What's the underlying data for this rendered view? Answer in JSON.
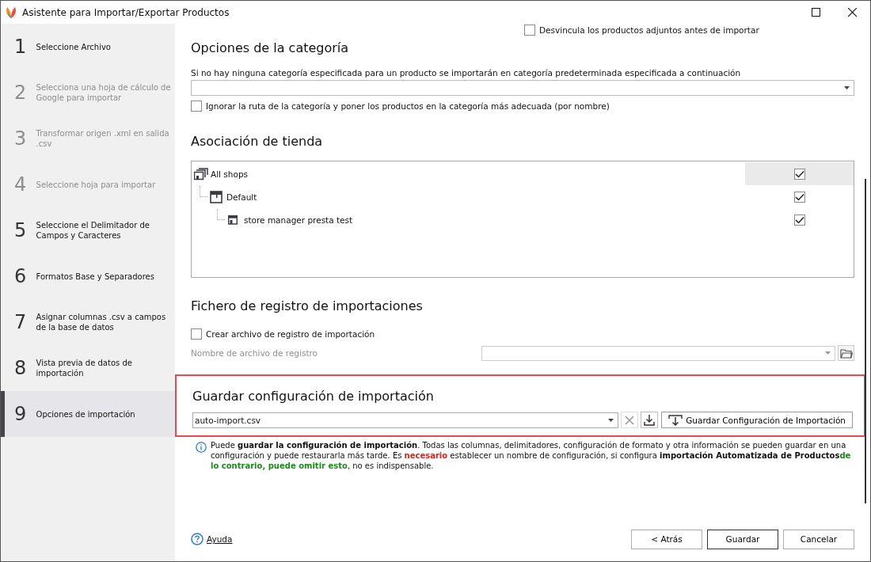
{
  "window": {
    "title": "Asistente para Importar/Exportar Productos"
  },
  "steps": [
    {
      "number": "1",
      "label": "Seleccione Archivo",
      "disabled": false,
      "selected": false
    },
    {
      "number": "2",
      "label": "Selecciona una hoja de cálculo de Google para importar",
      "disabled": true,
      "selected": false
    },
    {
      "number": "3",
      "label": "Transformar origen .xml en salida .csv",
      "disabled": true,
      "selected": false
    },
    {
      "number": "4",
      "label": "Seleccione hoja para importar",
      "disabled": true,
      "selected": false
    },
    {
      "number": "5",
      "label": "Seleccione el Delimitador de Campos y Caracteres",
      "disabled": false,
      "selected": false
    },
    {
      "number": "6",
      "label": "Formatos Base y Separadores",
      "disabled": false,
      "selected": false
    },
    {
      "number": "7",
      "label": "Asignar columnas .csv a campos de la base de datos",
      "disabled": false,
      "selected": false
    },
    {
      "number": "8",
      "label": "Vista previa de datos de importación",
      "disabled": false,
      "selected": false
    },
    {
      "number": "9",
      "label": "Opciones de importación",
      "disabled": false,
      "selected": true
    }
  ],
  "unlink_option": {
    "label": "Desvincula los productos adjuntos antes de importar",
    "checked": false
  },
  "category_section": {
    "title": "Opciones de la categoría",
    "description": "Si no hay ninguna categoría especificada para un producto se importarán en categoría predeterminada especificada a continuación",
    "ignore_path": {
      "label": "Ignorar la ruta de la categoría y poner los productos en la categoría más adecuada (por nombre)",
      "checked": false
    }
  },
  "store_section": {
    "title": "Asociación de tienda",
    "tree": [
      {
        "label": "All shops",
        "kind": "group",
        "checked": true,
        "selected": true,
        "children": [
          {
            "label": "Default",
            "kind": "shop-group",
            "checked": true,
            "selected": false,
            "children": [
              {
                "label": "store manager presta test",
                "kind": "store",
                "checked": true,
                "selected": false
              }
            ]
          }
        ]
      }
    ]
  },
  "log_section": {
    "title": "Fichero de registro de importaciones",
    "create_log": {
      "label": "Crear archivo de registro de importación",
      "checked": false
    },
    "file_name_label": "Nombre de archivo de registro",
    "disabled": true
  },
  "save_section": {
    "title": "Guardar configuración de importación",
    "highlighted": true,
    "config_value": "auto-import.csv",
    "save_button": "Guardar Configuración de Importación",
    "info": [
      {
        "kind": "plain",
        "text": "Puede "
      },
      {
        "kind": "bold",
        "text": "guardar la configuración de importación"
      },
      {
        "kind": "plain",
        "text": ". Todas las columnas, delimitadores, configuración de formato y otra información se pueden guardar en una configuración y puede restaurarla más tarde. Es "
      },
      {
        "kind": "red",
        "text": "necesario"
      },
      {
        "kind": "plain",
        "text": " establecer un nombre de configuración, si configura "
      },
      {
        "kind": "bold",
        "text": "importación Automatizada de Productos"
      },
      {
        "kind": "green",
        "text": "de lo contrario, puede omitir esto"
      },
      {
        "kind": "plain",
        "text": ", no es indispensable."
      }
    ]
  },
  "footer": {
    "help": "Ayuda",
    "buttons": [
      {
        "label": "< Atrás",
        "default": false
      },
      {
        "label": "Guardar",
        "default": true
      },
      {
        "label": "Cancelar",
        "default": false
      }
    ]
  }
}
